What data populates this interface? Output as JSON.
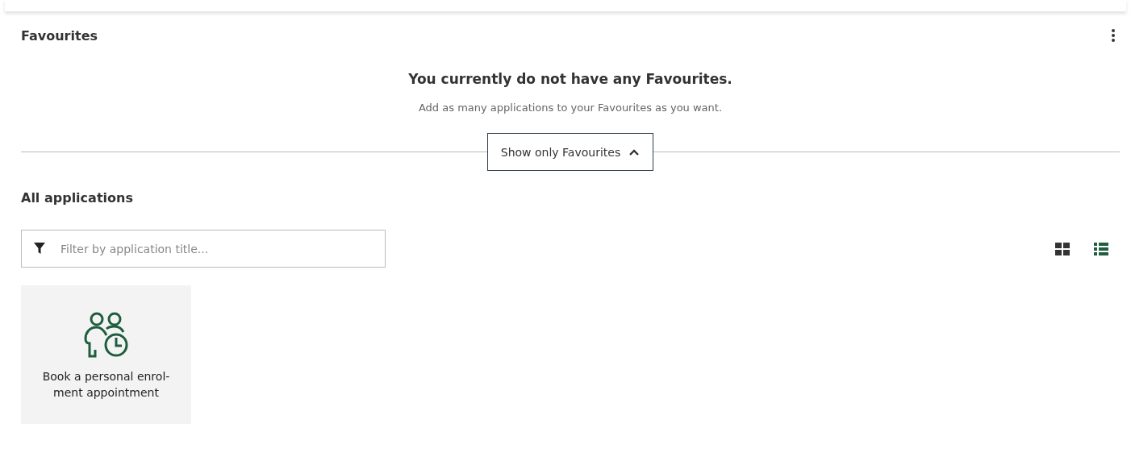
{
  "favourites": {
    "title": "Favourites",
    "empty_title": "You currently do not have any Favourites.",
    "empty_text": "Add as many applications to your Favourites as you want.",
    "toggle_button": {
      "label": "Show only Favourites",
      "expanded": true
    }
  },
  "applications": {
    "title": "All applications",
    "filter": {
      "placeholder": "Filter by application title..."
    },
    "views": [
      {
        "kind": "grid",
        "selected": true
      },
      {
        "kind": "list",
        "selected": false
      }
    ],
    "cards": [
      {
        "title": "Book a personal enrol-ment appointment"
      }
    ]
  }
}
